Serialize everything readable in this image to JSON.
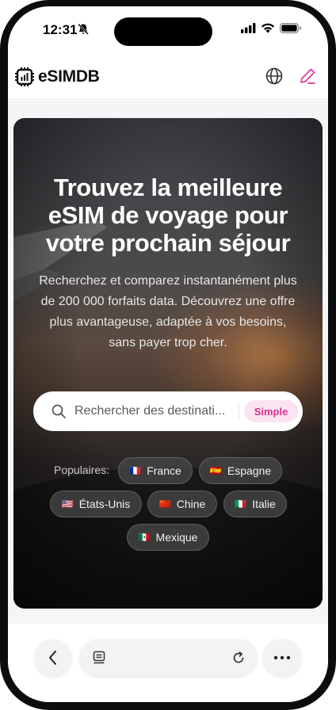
{
  "status_bar": {
    "time": "12:31",
    "icons": [
      "bell-slash-icon",
      "signal-icon",
      "wifi-icon",
      "battery-icon"
    ]
  },
  "header": {
    "logo_text": "eSIMDB",
    "logo_icon": "chip-icon",
    "language_icon": "globe-icon",
    "edit_icon": "pencil-icon",
    "accent_color": "#e0359b"
  },
  "hero": {
    "title": "Trouvez la meilleure eSIM de voyage pour votre prochain séjour",
    "subtitle": "Recherchez et comparez instantanément plus de 200 000 forfaits data. Découvrez une offre plus avantageuse, adaptée à vos besoins, sans payer trop cher.",
    "search": {
      "placeholder": "Rechercher des destinati...",
      "value": "",
      "mode_label": "Simple"
    },
    "popular_label": "Populaires:",
    "popular": [
      {
        "label": "France",
        "flag": "🇫🇷"
      },
      {
        "label": "Espagne",
        "flag": "🇪🇸"
      },
      {
        "label": "États-Unis",
        "flag": "🇺🇸"
      },
      {
        "label": "Chine",
        "flag": "🇨🇳"
      },
      {
        "label": "Italie",
        "flag": "🇮🇹"
      },
      {
        "label": "Mexique",
        "flag": "🇲🇽"
      }
    ]
  },
  "browser_bar": {
    "back_icon": "chevron-left-icon",
    "tabs_icon": "page-icon",
    "reload_icon": "reload-icon",
    "more_icon": "more-dots-icon"
  }
}
